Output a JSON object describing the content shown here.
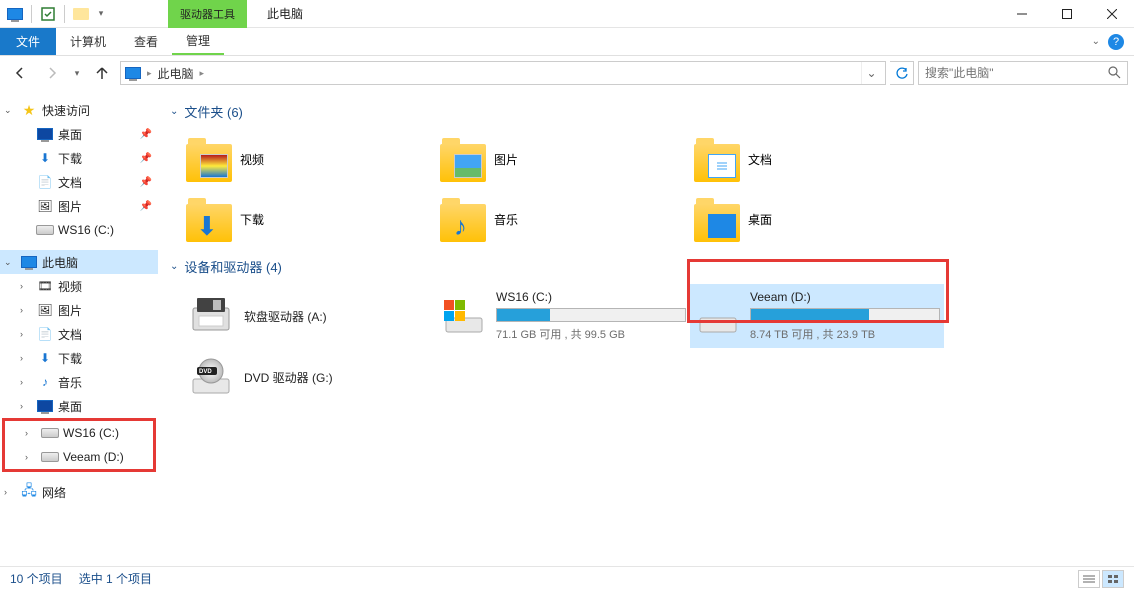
{
  "window": {
    "contextual_tab": "驱动器工具",
    "title": "此电脑"
  },
  "ribbon": {
    "file": "文件",
    "computer": "计算机",
    "view": "查看",
    "manage": "管理"
  },
  "addr": {
    "location": "此电脑",
    "search_placeholder": "搜索\"此电脑\""
  },
  "sidebar": {
    "quick_access": "快速访问",
    "desktop": "桌面",
    "downloads": "下载",
    "documents": "文档",
    "pictures": "图片",
    "ws16c": "WS16 (C:)",
    "this_pc": "此电脑",
    "video": "视频",
    "pictures2": "图片",
    "documents2": "文档",
    "downloads2": "下载",
    "music": "音乐",
    "desktop2": "桌面",
    "drive_c": "WS16 (C:)",
    "drive_d": "Veeam (D:)",
    "network": "网络"
  },
  "content": {
    "folders_header": "文件夹 (6)",
    "devices_header": "设备和驱动器 (4)",
    "folders": {
      "video": "视频",
      "pictures": "图片",
      "documents": "文档",
      "downloads": "下载",
      "music": "音乐",
      "desktop": "桌面"
    },
    "devices": {
      "floppy": "软盘驱动器 (A:)",
      "c_drive": "WS16 (C:)",
      "c_status": "71.1 GB 可用 , 共 99.5 GB",
      "d_drive": "Veeam (D:)",
      "d_status": "8.74 TB 可用 , 共 23.9 TB",
      "dvd": "DVD 驱动器 (G:)"
    }
  },
  "status": {
    "items": "10 个项目",
    "selected": "选中 1 个项目"
  }
}
